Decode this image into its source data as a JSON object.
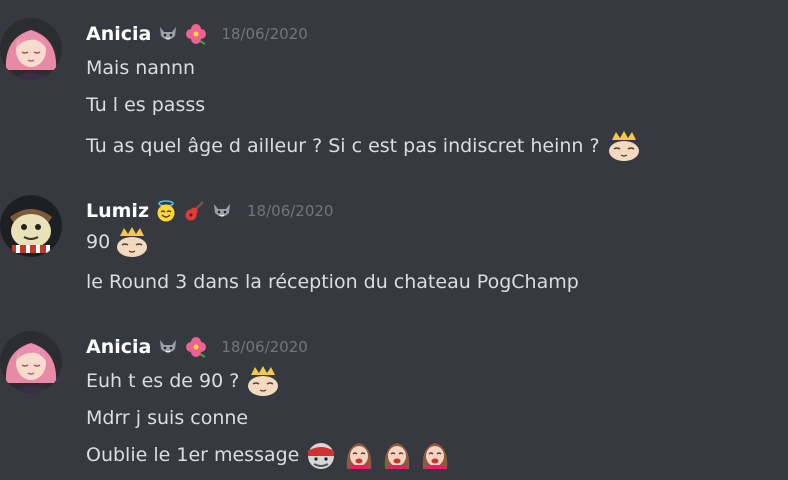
{
  "messages": [
    {
      "author": "Anicia",
      "timestamp": "18/06/2020",
      "badges": [
        "wolf-emoji",
        "hibiscus-emoji"
      ],
      "lines": [
        {
          "text": "Mais nannn",
          "emotes": []
        },
        {
          "text": "Tu l es passs",
          "emotes": []
        },
        {
          "text": "Tu as quel âge d ailleur ? Si c est pas indiscret heinn ?",
          "emotes": [
            "cat-crown-emote"
          ]
        }
      ]
    },
    {
      "author": "Lumiz",
      "timestamp": "18/06/2020",
      "badges": [
        "smiling-face-with-halo-emoji",
        "guitar-emoji",
        "wolf-emoji"
      ],
      "lines": [
        {
          "text": "90",
          "emotes": [
            "cat-crown-emote"
          ]
        },
        {
          "text": "le Round 3 dans la réception du chateau PogChamp",
          "emotes": []
        }
      ]
    },
    {
      "author": "Anicia",
      "timestamp": "18/06/2020",
      "badges": [
        "wolf-emoji",
        "hibiscus-emoji"
      ],
      "lines": [
        {
          "text": "Euh t es de 90 ?",
          "emotes": [
            "cat-crown-emote"
          ]
        },
        {
          "text": "Mdrr j suis conne",
          "emotes": []
        },
        {
          "text": "Oublie le 1er message",
          "emotes": [
            "red-bandana-emote",
            "laughing-girl-emote",
            "laughing-girl-emote",
            "laughing-girl-emote"
          ]
        }
      ]
    }
  ],
  "colors": {
    "background": "#36393f",
    "username": "#ffffff",
    "text": "#dcddde",
    "timestamp": "#72767d"
  }
}
